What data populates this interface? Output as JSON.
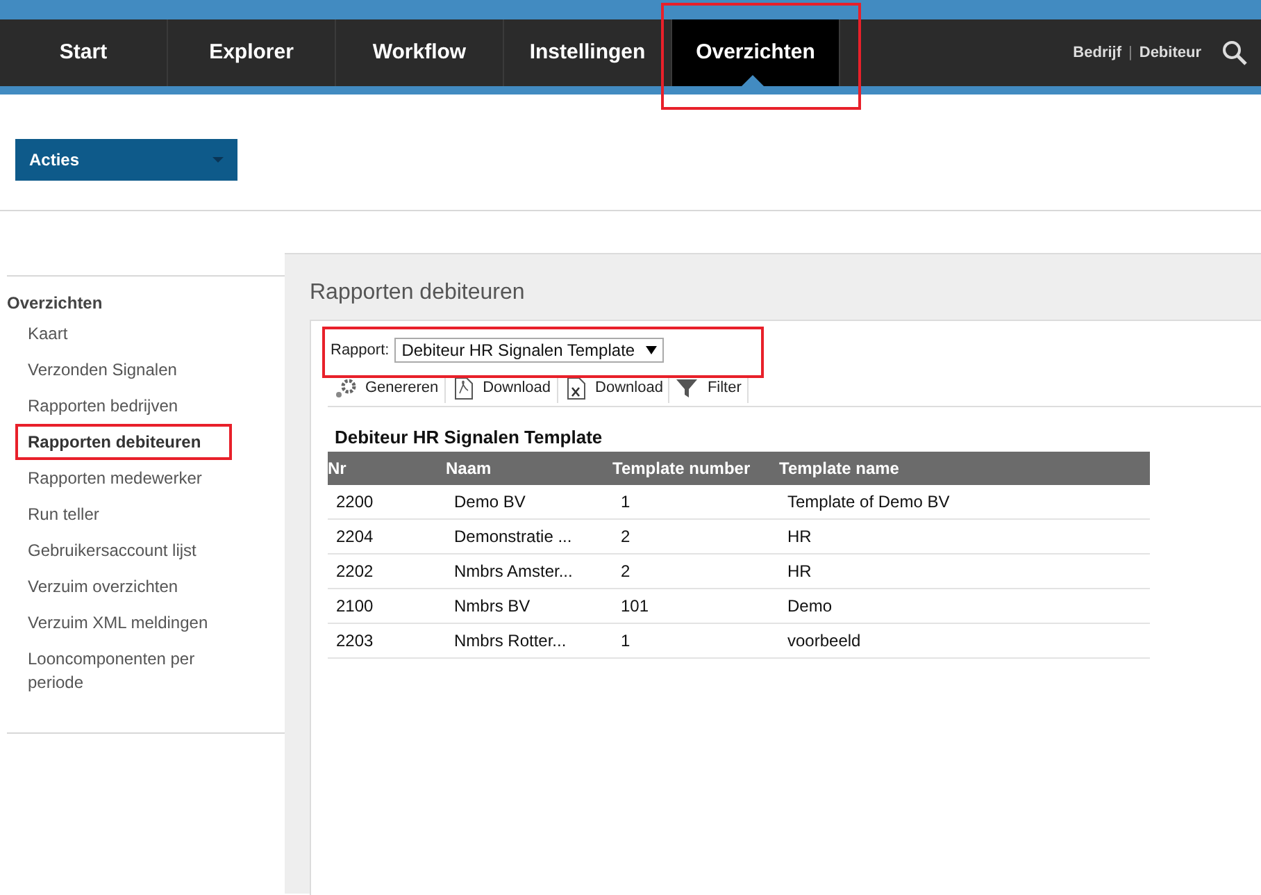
{
  "nav": {
    "tabs": [
      {
        "label": "Start",
        "selected": false,
        "annotated": false
      },
      {
        "label": "Explorer",
        "selected": false,
        "annotated": false
      },
      {
        "label": "Workflow",
        "selected": false,
        "annotated": false
      },
      {
        "label": "Instellingen",
        "selected": false,
        "annotated": false
      },
      {
        "label": "Overzichten",
        "selected": true,
        "annotated": true
      }
    ],
    "links": [
      "Bedrijf",
      "Debiteur"
    ],
    "separator": "|"
  },
  "actions_button": {
    "label": "Acties"
  },
  "sidebar": {
    "heading": "Overzichten",
    "items": [
      {
        "label": "Kaart",
        "selected": false,
        "annotated": false
      },
      {
        "label": "Verzonden Signalen",
        "selected": false,
        "annotated": false
      },
      {
        "label": "Rapporten bedrijven",
        "selected": false,
        "annotated": false
      },
      {
        "label": "Rapporten debiteuren",
        "selected": true,
        "annotated": true
      },
      {
        "label": "Rapporten medewerker",
        "selected": false,
        "annotated": false
      },
      {
        "label": "Run teller",
        "selected": false,
        "annotated": false
      },
      {
        "label": "Gebruikersaccount lijst",
        "selected": false,
        "annotated": false
      },
      {
        "label": "Verzuim overzichten",
        "selected": false,
        "annotated": false
      },
      {
        "label": "Verzuim XML meldingen",
        "selected": false,
        "annotated": false
      },
      {
        "label": "Looncomponenten per periode",
        "selected": false,
        "annotated": false
      }
    ]
  },
  "main": {
    "title": "Rapporten debiteuren",
    "report_select": {
      "label": "Rapport:",
      "value": "Debiteur HR Signalen Template",
      "annotated": true
    },
    "toolbar": [
      {
        "kind": "gears",
        "label": "Genereren"
      },
      {
        "kind": "pdf",
        "label": "Download"
      },
      {
        "kind": "excel",
        "label": "Download"
      },
      {
        "kind": "filter",
        "label": "Filter"
      }
    ],
    "table": {
      "title": "Debiteur HR Signalen Template",
      "columns": [
        "Nr",
        "Naam",
        "Template number",
        "Template name"
      ],
      "rows": [
        [
          "2200",
          "Demo BV",
          "1",
          "Template of Demo BV"
        ],
        [
          "2204",
          "Demonstratie ...",
          "2",
          "HR"
        ],
        [
          "2202",
          "Nmbrs Amster...",
          "2",
          "HR"
        ],
        [
          "2100",
          "Nmbrs BV",
          "101",
          "Demo"
        ],
        [
          "2203",
          "Nmbrs Rotter...",
          "1",
          "voorbeeld"
        ]
      ]
    }
  }
}
